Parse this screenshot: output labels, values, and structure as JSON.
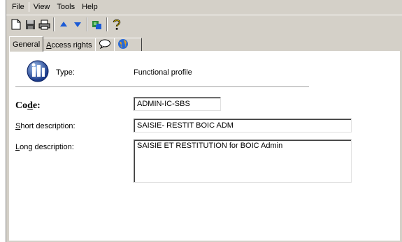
{
  "menu": {
    "items": [
      "File",
      "View",
      "Tools",
      "Help"
    ]
  },
  "toolbar": {
    "buttons": [
      "new-document-icon",
      "save-icon",
      "print-icon",
      "move-up-icon",
      "move-down-icon",
      "refresh-icon",
      "help-icon"
    ]
  },
  "tabs": [
    {
      "label": "General",
      "accel": ""
    },
    {
      "label": "ccess rights",
      "accel": "A"
    },
    {
      "icon": "comment-icon"
    },
    {
      "icon": "globe-icon"
    }
  ],
  "form": {
    "type_label": "Type:",
    "type_value": "Functional profile",
    "code_label_pre": "Co",
    "code_label_accel": "d",
    "code_label_post": "e:",
    "code_value": "ADMIN-IC-SBS",
    "short_label_accel": "S",
    "short_label_rest": "hort description:",
    "short_value": "SAISIE- RESTIT BOIC ADM",
    "long_label_accel": "L",
    "long_label_rest": "ong description:",
    "long_value": "SAISIE ET RESTITUTION for BOIC Admin"
  },
  "colors": {
    "chrome": "#d4d0c8",
    "panel": "#ffffff",
    "accent_blue": "#1a5ad6"
  }
}
